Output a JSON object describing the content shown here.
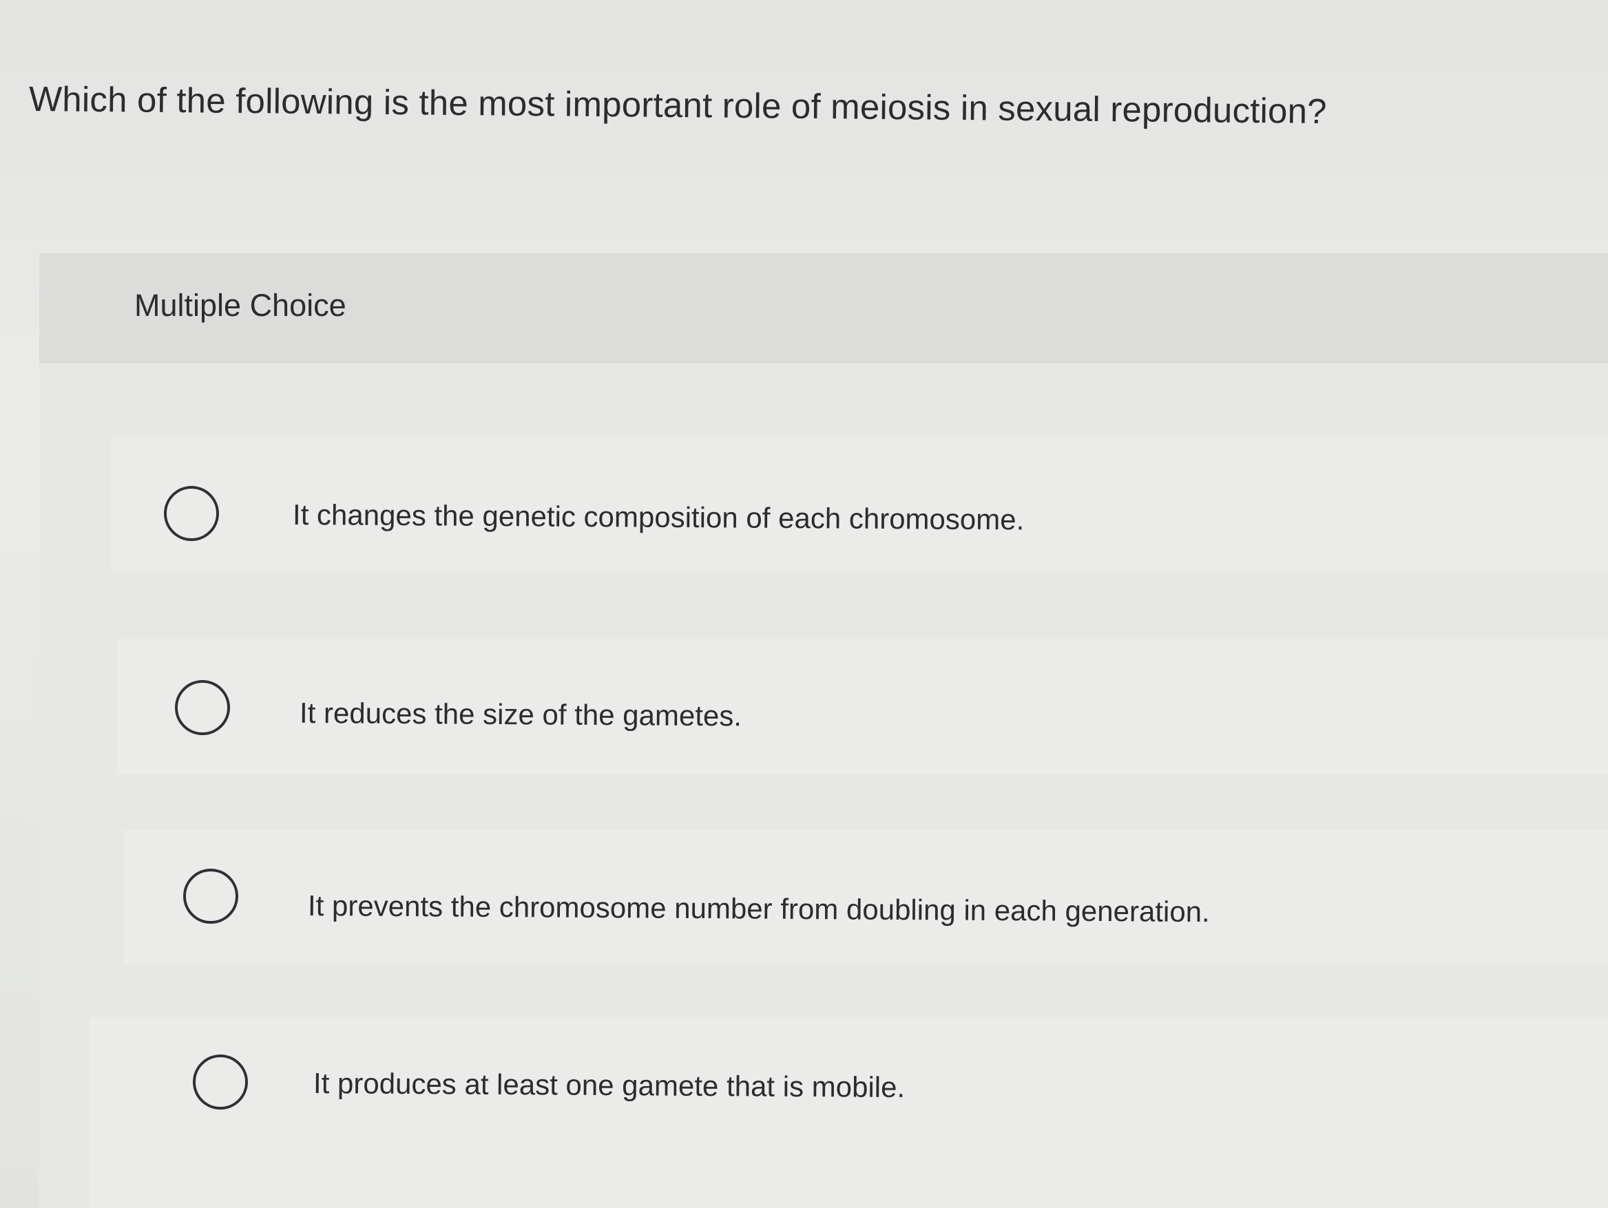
{
  "question": {
    "text": "Which of the following is the most important role of meiosis in sexual reproduction?"
  },
  "section": {
    "label": "Multiple Choice"
  },
  "choices": [
    {
      "text": "It changes the genetic composition of each chromosome."
    },
    {
      "text": "It reduces the size of the gametes."
    },
    {
      "text": "It prevents the chromosome number from doubling in each generation."
    },
    {
      "text": "It produces at least one gamete that is mobile."
    }
  ]
}
